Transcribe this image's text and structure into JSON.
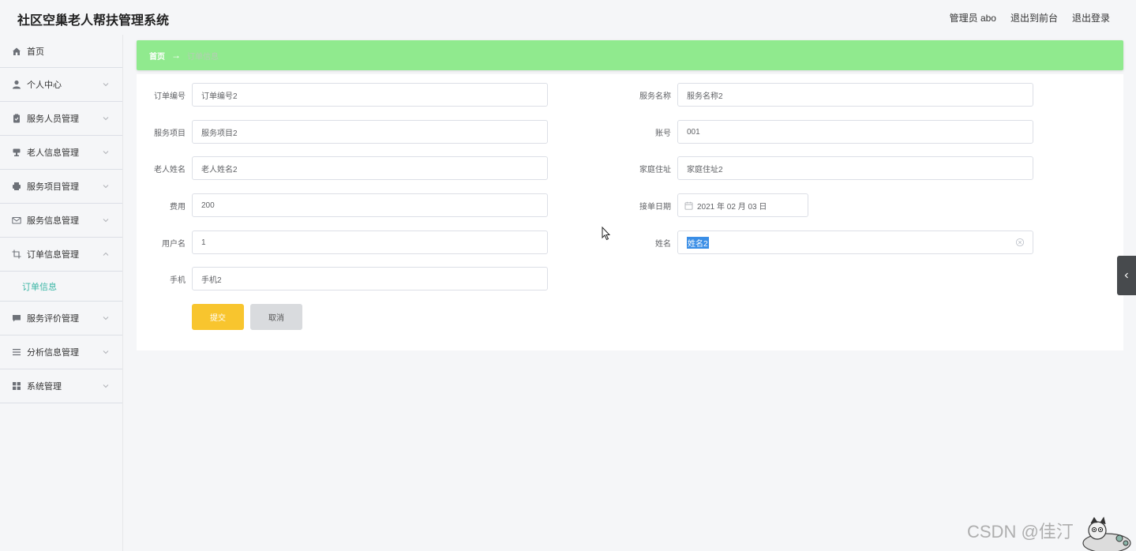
{
  "header": {
    "title": "社区空巢老人帮扶管理系统",
    "admin": "管理员 abo",
    "back_to_front": "退出到前台",
    "logout": "退出登录"
  },
  "sidebar": {
    "items": [
      {
        "label": "首页",
        "icon": "home-icon"
      },
      {
        "label": "个人中心",
        "icon": "user-icon"
      },
      {
        "label": "服务人员管理",
        "icon": "clipboard-icon"
      },
      {
        "label": "老人信息管理",
        "icon": "stamp-icon"
      },
      {
        "label": "服务项目管理",
        "icon": "printer-icon"
      },
      {
        "label": "服务信息管理",
        "icon": "mail-icon"
      },
      {
        "label": "订单信息管理",
        "icon": "crop-icon"
      },
      {
        "label": "服务评价管理",
        "icon": "comment-icon"
      },
      {
        "label": "分析信息管理",
        "icon": "list-icon"
      },
      {
        "label": "系统管理",
        "icon": "grid-icon"
      }
    ],
    "submenu_active": "订单信息"
  },
  "breadcrumb": {
    "home": "首页",
    "separator": "→",
    "current": "订单信息"
  },
  "form": {
    "order_no": {
      "label": "订单编号",
      "value": "订单编号2"
    },
    "service_name": {
      "label": "服务名称",
      "value": "服务名称2"
    },
    "service_item": {
      "label": "服务项目",
      "value": "服务项目2"
    },
    "account": {
      "label": "账号",
      "value": "001"
    },
    "elder_name": {
      "label": "老人姓名",
      "value": "老人姓名2"
    },
    "home_address": {
      "label": "家庭住址",
      "value": "家庭住址2"
    },
    "fee": {
      "label": "费用",
      "value": "200"
    },
    "order_date": {
      "label": "接单日期",
      "value": "2021 年 02 月 03 日"
    },
    "username": {
      "label": "用户名",
      "value": "1"
    },
    "name": {
      "label": "姓名",
      "value": "姓名2"
    },
    "phone": {
      "label": "手机",
      "value": "手机2"
    },
    "submit": "提交",
    "cancel": "取消"
  },
  "watermark": "CSDN @佳汀"
}
